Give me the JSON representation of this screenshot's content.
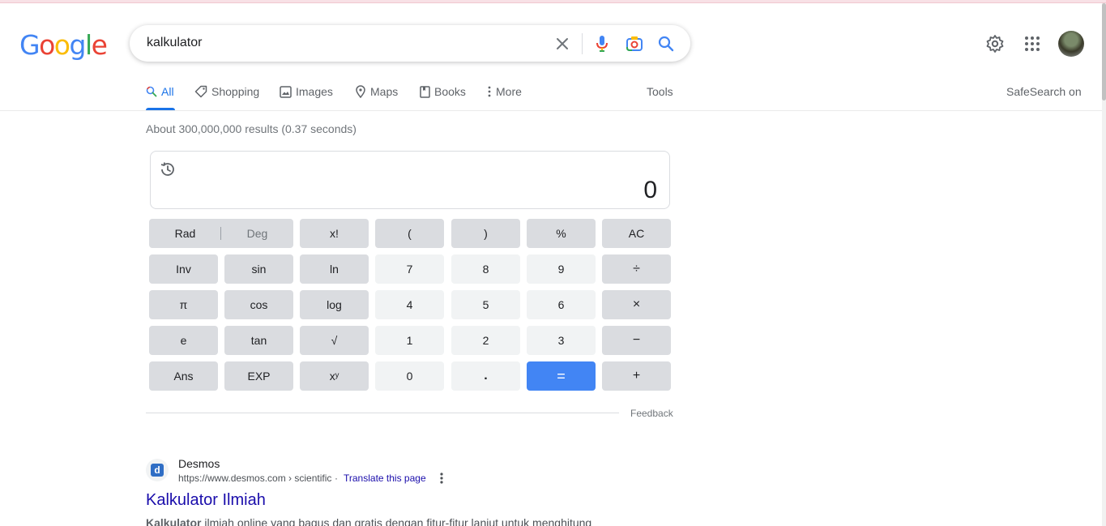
{
  "search": {
    "query": "kalkulator"
  },
  "logo": {
    "letters": [
      "G",
      "o",
      "o",
      "g",
      "l",
      "e"
    ],
    "colors": [
      "#4285f4",
      "#ea4335",
      "#fbbc05",
      "#4285f4",
      "#34a853",
      "#ea4335"
    ]
  },
  "tabs": [
    {
      "label": "All",
      "icon": "search-icon",
      "active": true
    },
    {
      "label": "Shopping",
      "icon": "tag-icon"
    },
    {
      "label": "Images",
      "icon": "image-icon"
    },
    {
      "label": "Maps",
      "icon": "map-pin-icon"
    },
    {
      "label": "Books",
      "icon": "book-icon"
    },
    {
      "label": "More",
      "icon": "more-vert-icon"
    }
  ],
  "tools_label": "Tools",
  "safesearch_label": "SafeSearch on",
  "results_stats": "About 300,000,000 results (0.37 seconds)",
  "calculator": {
    "display": "0",
    "rad_label": "Rad",
    "deg_label": "Deg",
    "keys": [
      [
        "x!",
        "(",
        ")",
        "%",
        "AC"
      ],
      [
        "Inv",
        "sin",
        "ln",
        "7",
        "8",
        "9",
        "÷"
      ],
      [
        "π",
        "cos",
        "log",
        "4",
        "5",
        "6",
        "×"
      ],
      [
        "e",
        "tan",
        "√",
        "1",
        "2",
        "3",
        "−"
      ],
      [
        "Ans",
        "EXP",
        "xʸ",
        "0",
        ".",
        "=",
        "+"
      ]
    ]
  },
  "feedback_label": "Feedback",
  "result": {
    "site_name": "Desmos",
    "favicon_letter": "d",
    "url": "https://www.desmos.com › scientific",
    "separator": "·",
    "translate_label": "Translate this page",
    "title": "Kalkulator Ilmiah",
    "snippet_bold": "Kalkulator",
    "snippet_rest": " ilmiah online yang bagus dan gratis dengan fitur-fitur lanjut untuk menghitung"
  },
  "colors": {
    "accent": "#1a73e8",
    "equals_key": "#4285f4",
    "link": "#1a0dab"
  }
}
